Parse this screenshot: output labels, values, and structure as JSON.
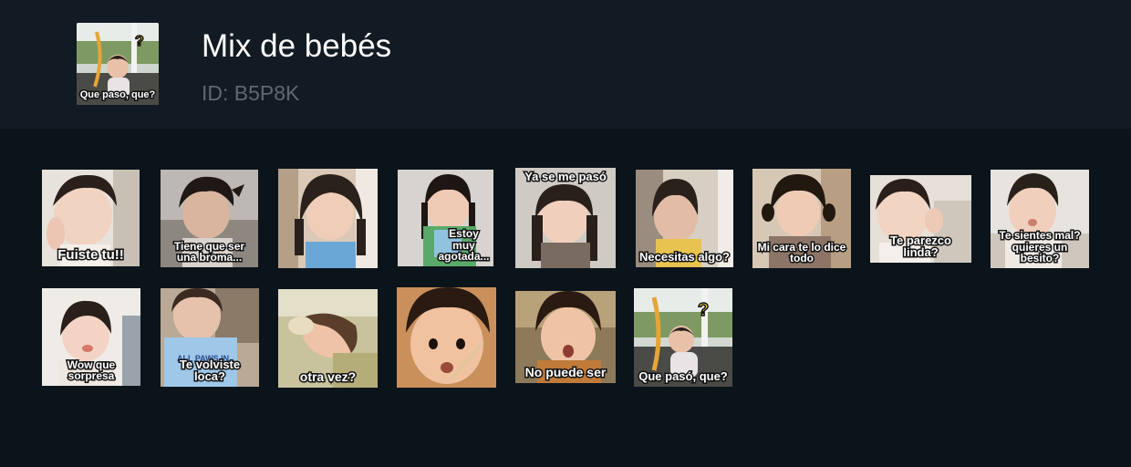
{
  "pack": {
    "title": "Mix de bebés",
    "id_label": "ID: B5P8K",
    "thumb_caption": "Que paso, que?"
  },
  "stickers": [
    {
      "caption": "Fuiste tu!!"
    },
    {
      "caption": "Tiene que ser una broma..."
    },
    {
      "caption": ""
    },
    {
      "caption": "Estoy muy agotada..."
    },
    {
      "caption": "Ya se me pasó"
    },
    {
      "caption": "Necesitas algo?"
    },
    {
      "caption": "Mi cara te lo dice todo"
    },
    {
      "caption": "Te parezco linda?"
    },
    {
      "caption": "Te sientes mal? quieres un besito?"
    },
    {
      "caption": "Wow que sorpresa"
    },
    {
      "caption": "Te volviste loca?"
    },
    {
      "caption": "otra vez?"
    },
    {
      "caption": ""
    },
    {
      "caption": "No puede ser"
    },
    {
      "caption": "Que pasó, que?"
    }
  ],
  "colors": {
    "header_bg": "#121b23",
    "page_bg": "#0c141b",
    "title": "#ffffff",
    "id_text": "#5f6870"
  }
}
